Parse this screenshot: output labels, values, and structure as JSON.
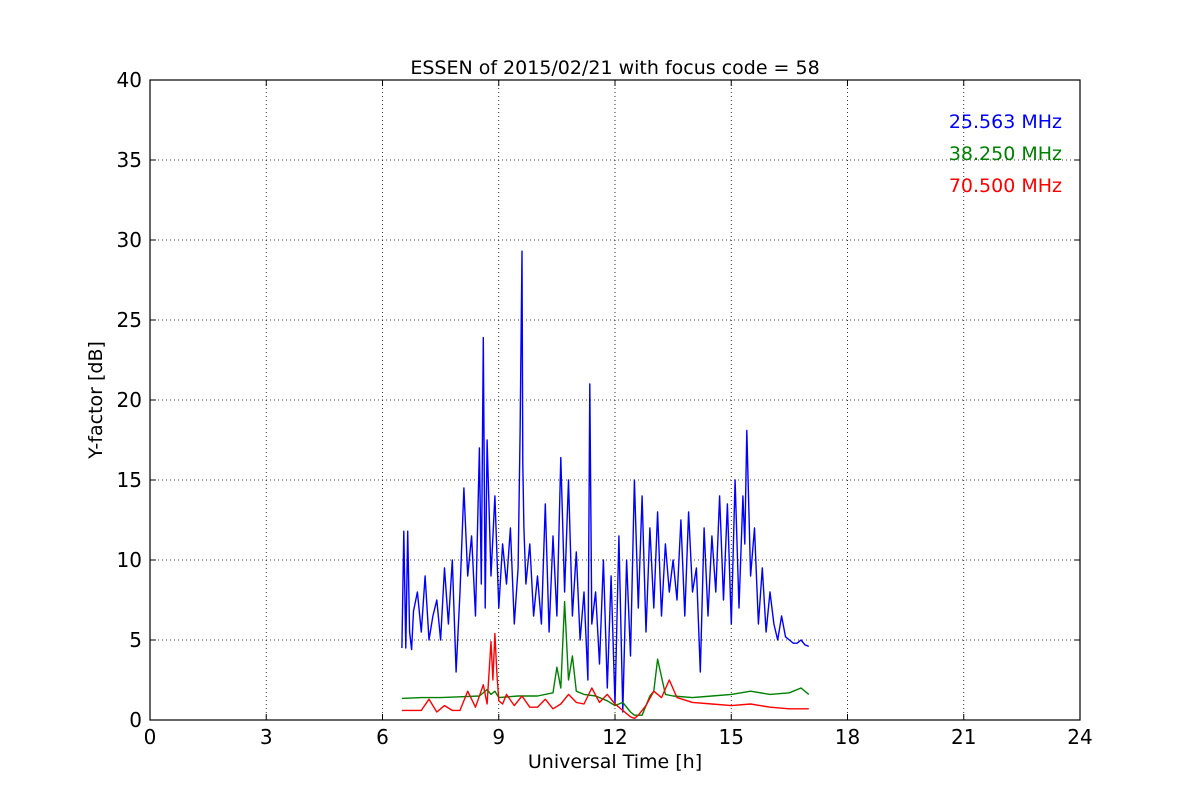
{
  "chart_data": {
    "type": "line",
    "title": "ESSEN of 2015/02/21 with focus code = 58",
    "xlabel": "Universal Time [h]",
    "ylabel": "Y-factor [dB]",
    "xlim": [
      0,
      24
    ],
    "ylim": [
      0,
      40
    ],
    "xticks": [
      0,
      3,
      6,
      9,
      12,
      15,
      18,
      21,
      24
    ],
    "yticks": [
      0,
      5,
      10,
      15,
      20,
      25,
      30,
      35,
      40
    ],
    "grid": true,
    "legend_position": "top-right",
    "series": [
      {
        "name": "25.563 MHz",
        "color": "#0000ff",
        "x": [
          6.5,
          6.55,
          6.6,
          6.65,
          6.7,
          6.75,
          6.8,
          6.9,
          7.0,
          7.1,
          7.2,
          7.3,
          7.4,
          7.5,
          7.6,
          7.7,
          7.8,
          7.9,
          8.0,
          8.1,
          8.2,
          8.3,
          8.4,
          8.5,
          8.55,
          8.6,
          8.65,
          8.7,
          8.8,
          8.9,
          9.0,
          9.1,
          9.2,
          9.3,
          9.4,
          9.5,
          9.55,
          9.6,
          9.62,
          9.65,
          9.7,
          9.8,
          9.9,
          10.0,
          10.1,
          10.2,
          10.3,
          10.4,
          10.5,
          10.6,
          10.7,
          10.8,
          10.9,
          11.0,
          11.1,
          11.2,
          11.3,
          11.35,
          11.4,
          11.5,
          11.6,
          11.7,
          11.8,
          11.9,
          12.0,
          12.1,
          12.2,
          12.3,
          12.4,
          12.5,
          12.6,
          12.7,
          12.8,
          12.9,
          13.0,
          13.1,
          13.2,
          13.3,
          13.4,
          13.5,
          13.6,
          13.7,
          13.8,
          13.9,
          14.0,
          14.1,
          14.2,
          14.3,
          14.4,
          14.5,
          14.6,
          14.7,
          14.8,
          14.9,
          15.0,
          15.1,
          15.2,
          15.3,
          15.35,
          15.4,
          15.5,
          15.6,
          15.7,
          15.8,
          15.9,
          16.0,
          16.1,
          16.2,
          16.3,
          16.4,
          16.5,
          16.6,
          16.7,
          16.8,
          16.9,
          17.0
        ],
        "values": [
          4.5,
          11.8,
          4.5,
          11.8,
          5.5,
          4.4,
          6.8,
          8.0,
          5.5,
          9.0,
          5.0,
          6.5,
          7.5,
          5.0,
          9.5,
          6.0,
          10.0,
          3.0,
          8.0,
          14.5,
          9.0,
          11.5,
          6.5,
          17.0,
          8.5,
          23.9,
          7.0,
          17.5,
          9.0,
          14.0,
          7.0,
          11.0,
          8.5,
          12.0,
          6.0,
          9.5,
          18.0,
          29.3,
          16.0,
          12.0,
          8.5,
          11.0,
          6.5,
          9.0,
          6.0,
          13.5,
          5.5,
          11.5,
          6.5,
          16.4,
          8.0,
          15.0,
          6.5,
          10.5,
          5.0,
          8.0,
          2.5,
          21.0,
          6.0,
          8.0,
          3.5,
          10.0,
          2.0,
          9.0,
          1.0,
          11.5,
          0.5,
          10.0,
          4.0,
          15.0,
          7.0,
          14.0,
          5.5,
          12.0,
          7.0,
          13.0,
          6.5,
          11.0,
          8.0,
          10.0,
          7.5,
          12.5,
          6.5,
          13.0,
          8.0,
          9.5,
          3.0,
          12.0,
          6.5,
          11.5,
          8.0,
          14.0,
          7.5,
          13.5,
          6.0,
          15.0,
          7.0,
          14.0,
          11.0,
          18.1,
          9.0,
          12.0,
          6.0,
          9.5,
          5.5,
          8.0,
          6.0,
          5.0,
          6.5,
          5.2,
          5.0,
          4.8,
          4.8,
          5.0,
          4.7,
          4.6
        ]
      },
      {
        "name": "38.250 MHz",
        "color": "#008000",
        "x": [
          6.5,
          7.0,
          7.5,
          8.0,
          8.5,
          8.7,
          8.8,
          8.9,
          9.0,
          9.5,
          10.0,
          10.4,
          10.5,
          10.6,
          10.7,
          10.8,
          10.9,
          11.0,
          11.2,
          11.5,
          11.8,
          12.0,
          12.2,
          12.4,
          12.5,
          12.7,
          12.9,
          13.0,
          13.1,
          13.3,
          13.5,
          14.0,
          14.5,
          15.0,
          15.5,
          16.0,
          16.5,
          16.8,
          17.0
        ],
        "values": [
          1.35,
          1.4,
          1.4,
          1.45,
          1.5,
          1.9,
          1.6,
          1.8,
          1.4,
          1.5,
          1.5,
          1.7,
          3.3,
          2.0,
          7.4,
          2.5,
          4.0,
          1.8,
          1.6,
          1.5,
          1.2,
          0.9,
          1.1,
          0.5,
          0.3,
          0.3,
          1.5,
          1.8,
          3.8,
          1.6,
          1.5,
          1.4,
          1.5,
          1.6,
          1.8,
          1.6,
          1.7,
          2.0,
          1.6
        ]
      },
      {
        "name": "70.500 MHz",
        "color": "#ff0000",
        "x": [
          6.5,
          7.0,
          7.2,
          7.4,
          7.6,
          7.8,
          8.0,
          8.2,
          8.4,
          8.6,
          8.7,
          8.8,
          8.85,
          8.9,
          8.95,
          9.0,
          9.1,
          9.2,
          9.4,
          9.6,
          9.8,
          10.0,
          10.2,
          10.4,
          10.6,
          10.8,
          11.0,
          11.2,
          11.4,
          11.6,
          11.8,
          12.0,
          12.2,
          12.4,
          12.5,
          12.6,
          12.8,
          13.0,
          13.2,
          13.4,
          13.6,
          14.0,
          14.5,
          15.0,
          15.5,
          16.0,
          16.5,
          17.0
        ],
        "values": [
          0.6,
          0.6,
          1.3,
          0.5,
          0.9,
          0.6,
          0.6,
          1.8,
          0.8,
          2.2,
          1.0,
          4.9,
          2.5,
          5.4,
          3.0,
          1.2,
          1.0,
          1.6,
          0.9,
          1.5,
          0.8,
          0.8,
          1.3,
          0.7,
          1.0,
          1.6,
          1.1,
          1.0,
          2.0,
          1.1,
          1.6,
          1.0,
          0.6,
          0.2,
          0.1,
          0.3,
          0.9,
          1.8,
          1.4,
          2.5,
          1.4,
          1.1,
          1.0,
          0.9,
          1.0,
          0.8,
          0.7,
          0.7
        ]
      }
    ]
  }
}
